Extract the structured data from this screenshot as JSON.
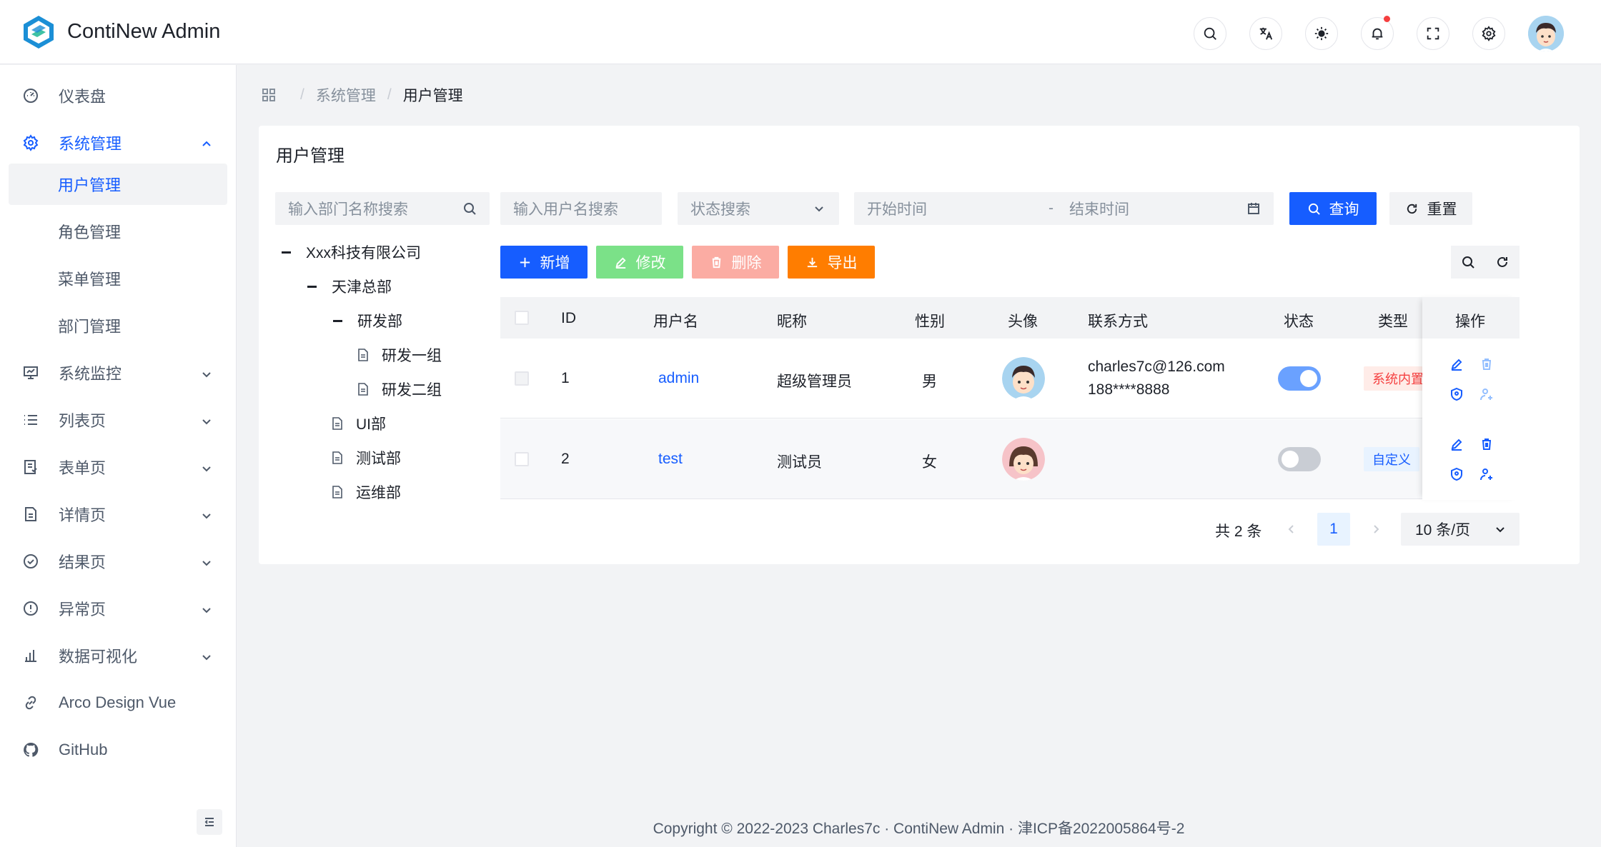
{
  "app": {
    "title": "ContiNew Admin"
  },
  "header": {
    "icons": [
      "search-icon",
      "translate-icon",
      "theme-icon",
      "bell-icon",
      "fullscreen-icon",
      "settings-icon"
    ]
  },
  "sidebar": {
    "items": [
      {
        "label": "仪表盘",
        "icon": "dashboard-icon"
      },
      {
        "label": "系统管理",
        "icon": "settings-icon",
        "expanded": true
      },
      {
        "label": "系统监控",
        "icon": "monitor-icon"
      },
      {
        "label": "列表页",
        "icon": "list-icon"
      },
      {
        "label": "表单页",
        "icon": "form-icon"
      },
      {
        "label": "详情页",
        "icon": "file-icon"
      },
      {
        "label": "结果页",
        "icon": "check-circle-icon"
      },
      {
        "label": "异常页",
        "icon": "exclamation-icon"
      },
      {
        "label": "数据可视化",
        "icon": "bar-chart-icon"
      },
      {
        "label": "Arco Design Vue",
        "icon": "link-icon"
      },
      {
        "label": "GitHub",
        "icon": "github-icon"
      }
    ],
    "sub_items": [
      "用户管理",
      "角色管理",
      "菜单管理",
      "部门管理"
    ]
  },
  "breadcrumb": {
    "items": [
      "系统管理",
      "用户管理"
    ]
  },
  "card": {
    "title": "用户管理"
  },
  "filters": {
    "dept_search_placeholder": "输入部门名称搜索",
    "user_search_placeholder": "输入用户名搜索",
    "status_placeholder": "状态搜索",
    "start_placeholder": "开始时间",
    "range_sep": "-",
    "end_placeholder": "结束时间",
    "query_label": "查询",
    "reset_label": "重置"
  },
  "toolbar": {
    "add_label": "新增",
    "edit_label": "修改",
    "delete_label": "删除",
    "export_label": "导出"
  },
  "tree": [
    {
      "label": "Xxx科技有限公司",
      "level": 0,
      "type": "branch"
    },
    {
      "label": "天津总部",
      "level": 1,
      "type": "branch"
    },
    {
      "label": "研发部",
      "level": 2,
      "type": "branch"
    },
    {
      "label": "研发一组",
      "level": 3,
      "type": "leaf"
    },
    {
      "label": "研发二组",
      "level": 3,
      "type": "leaf"
    },
    {
      "label": "UI部",
      "level": 2,
      "type": "leaf"
    },
    {
      "label": "测试部",
      "level": 2,
      "type": "leaf"
    },
    {
      "label": "运维部",
      "level": 2,
      "type": "leaf"
    }
  ],
  "table": {
    "columns": [
      "ID",
      "用户名",
      "昵称",
      "性别",
      "头像",
      "联系方式",
      "状态",
      "类型",
      "操作"
    ],
    "rows": [
      {
        "id": "1",
        "username": "admin",
        "nickname": "超级管理员",
        "gender": "男",
        "avatar": "male-avatar",
        "email": "charles7c@126.com",
        "phone": "188****8888",
        "status_enabled": true,
        "type": "系统内置"
      },
      {
        "id": "2",
        "username": "test",
        "nickname": "测试员",
        "gender": "女",
        "avatar": "female-avatar",
        "email": "",
        "phone": "",
        "status_enabled": false,
        "type": "自定义"
      }
    ]
  },
  "pagination": {
    "total_label": "共 2 条",
    "current_page": "1",
    "page_size_label": "10 条/页"
  },
  "footer": {
    "text": "Copyright © 2022-2023 Charles7c · ContiNew Admin · 津ICP备2022005864号-2"
  },
  "colors": {
    "primary": "#165dff",
    "success": "#7be188",
    "danger_light": "#fbaca3",
    "warning": "#ff7d00"
  }
}
